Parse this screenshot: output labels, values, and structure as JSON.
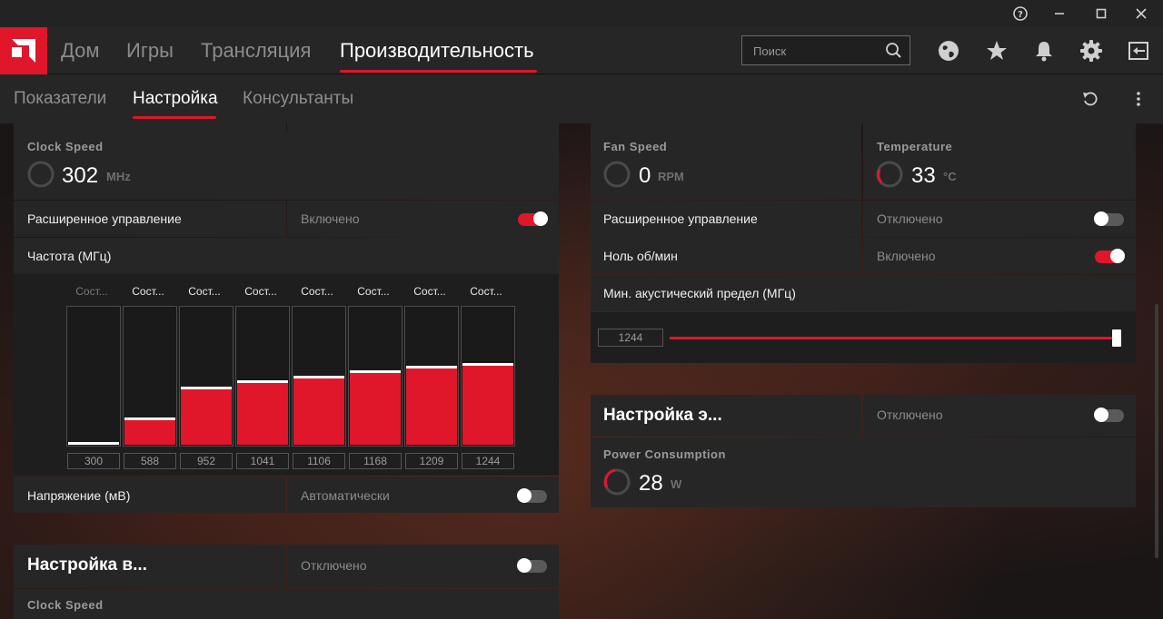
{
  "window": {
    "help_glyph": "?",
    "minimize_glyph": "—",
    "maximize_glyph": "□",
    "close_glyph": "✕"
  },
  "nav": {
    "tabs": [
      {
        "label": "Дом"
      },
      {
        "label": "Игры"
      },
      {
        "label": "Трансляция"
      },
      {
        "label": "Производительность"
      }
    ],
    "active_tab": "Производительность",
    "search_placeholder": "Поиск",
    "icons": [
      "search-icon",
      "globe-icon",
      "star-icon",
      "bell-icon",
      "gear-icon",
      "exit-icon"
    ]
  },
  "subnav": {
    "tabs": [
      {
        "label": "Показатели"
      },
      {
        "label": "Настройка"
      },
      {
        "label": "Консультанты"
      }
    ],
    "active_tab": "Настройка",
    "icons": [
      "reset-icon",
      "more-vertical-icon"
    ]
  },
  "gpu_panel": {
    "clock_speed": {
      "label": "Clock Speed",
      "value": "302",
      "unit": "MHz"
    },
    "advanced": {
      "label": "Расширенное управление",
      "value": "Включено",
      "toggle_on": true
    },
    "frequency": {
      "label": "Частота (МГц)",
      "states": [
        "Сост...",
        "Сост...",
        "Сост...",
        "Сост...",
        "Сост...",
        "Сост...",
        "Сост...",
        "Сост..."
      ],
      "values": [
        "300",
        "588",
        "952",
        "1041",
        "1106",
        "1168",
        "1209",
        "1244"
      ],
      "levels": [
        0.0,
        0.18,
        0.4,
        0.45,
        0.48,
        0.52,
        0.55,
        0.57
      ]
    },
    "voltage": {
      "label": "Напряжение (мВ)",
      "value": "Автоматически",
      "toggle_on": false
    }
  },
  "vram_panel": {
    "title": "Настройка в...",
    "value": "Отключено",
    "toggle_on": false,
    "clock_speed_label": "Clock Speed"
  },
  "fan_panel": {
    "fan_speed": {
      "label": "Fan Speed",
      "value": "0",
      "unit": "RPM"
    },
    "temperature": {
      "label": "Temperature",
      "value": "33",
      "unit": "°C"
    },
    "advanced": {
      "label": "Расширенное управление",
      "value": "Отключено",
      "toggle_on": false
    },
    "zero_rpm": {
      "label": "Ноль об/мин",
      "value": "Включено",
      "toggle_on": true
    },
    "acoustic": {
      "label": "Мин. акустический предел (МГц)",
      "value": "1244",
      "level": 1.0
    }
  },
  "power_panel": {
    "title": "Настройка э...",
    "value": "Отключено",
    "toggle_on": false,
    "consumption": {
      "label": "Power Consumption",
      "value": "28",
      "unit": "W"
    }
  },
  "colors": {
    "accent": "#e0162b",
    "panel": "#262626",
    "panel_dark": "#1e1e1e"
  }
}
